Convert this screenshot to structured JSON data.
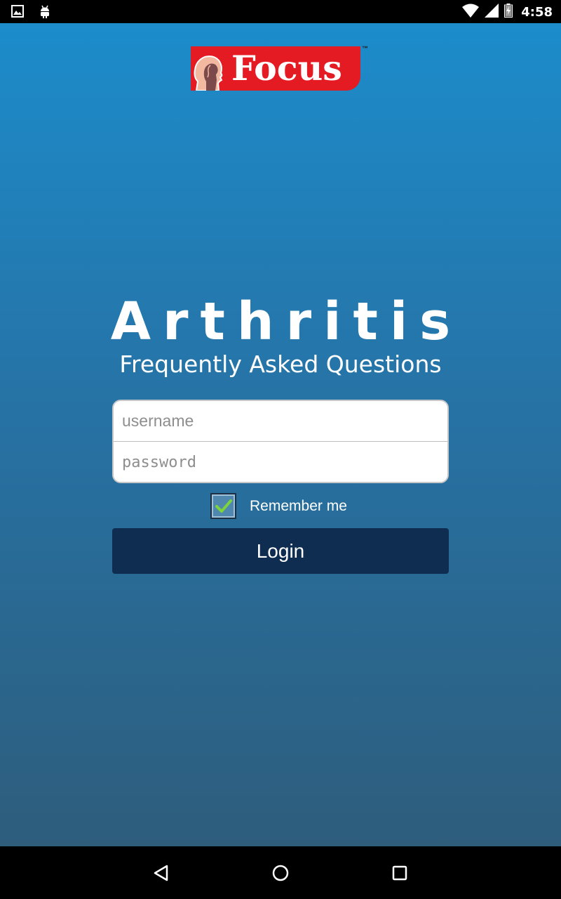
{
  "status_bar": {
    "time": "4:58",
    "left_icons": [
      "image-icon",
      "android-debug-icon"
    ],
    "right_icons": [
      "wifi-icon",
      "cell-signal-icon",
      "battery-charging-icon"
    ]
  },
  "logo": {
    "text": "Focus",
    "trademark": "™",
    "color": "#e51b24"
  },
  "title": "Arthritis",
  "subtitle": "Frequently Asked Questions",
  "form": {
    "username_placeholder": "username",
    "password_placeholder": "password",
    "remember_label": "Remember me",
    "remember_checked": true,
    "login_label": "Login"
  },
  "colors": {
    "gradient_top": "#1c8ccb",
    "gradient_bottom": "#2e5d7c",
    "login_button": "#0e2d51",
    "check_mark": "#7cd33a"
  },
  "nav_bar": {
    "buttons": [
      "back-icon",
      "home-icon",
      "recents-icon"
    ]
  }
}
